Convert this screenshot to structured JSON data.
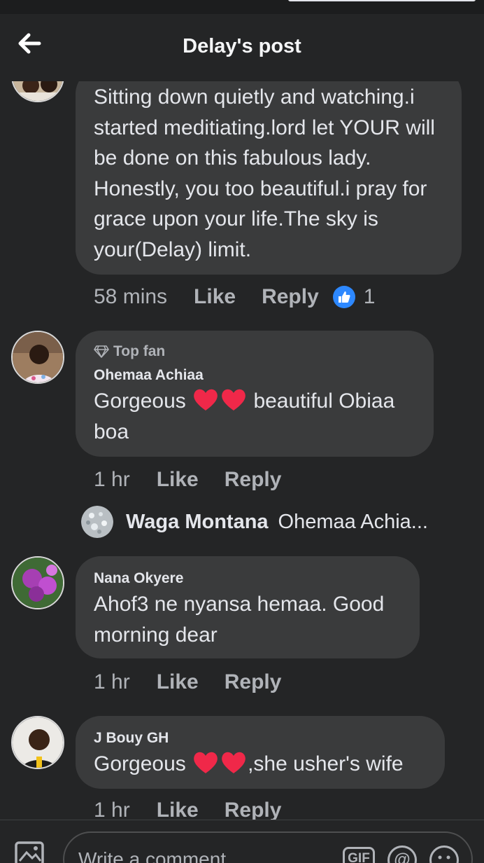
{
  "header": {
    "title": "Delay's post"
  },
  "comments": [
    {
      "text": "Sitting down quietly and watching.i started meditiating.lord let YOUR will be done on this fabulous lady. Honestly, you too beautiful.i pray for grace upon your life.The sky is your(Delay) limit.",
      "time": "58 mins",
      "like_label": "Like",
      "reply_label": "Reply",
      "reaction_count": "1"
    },
    {
      "badge": "Top fan",
      "name": "Ohemaa Achiaa",
      "text_before": "Gorgeous",
      "text_after": "beautiful Obiaa boa",
      "time": "1 hr",
      "like_label": "Like",
      "reply_label": "Reply",
      "reply_preview": {
        "name": "Waga Montana",
        "text": "Ohemaa Achia..."
      }
    },
    {
      "name": "Nana Okyere",
      "text": "Ahof3 ne nyansa hemaa. Good morning dear",
      "time": "1 hr",
      "like_label": "Like",
      "reply_label": "Reply"
    },
    {
      "name": "J Bouy GH",
      "text_before": "Gorgeous",
      "text_after": ",she usher's wife",
      "time": "1 hr",
      "like_label": "Like",
      "reply_label": "Reply"
    }
  ],
  "composer": {
    "placeholder": "Write a comment...",
    "gif_label": "GIF",
    "mention_label": "@"
  },
  "colors": {
    "background": "#242526",
    "bubble": "#3a3b3c",
    "text": "#e4e6eb",
    "muted": "#b0b3b8",
    "like_blue": "#2d88ff",
    "heart": "#f02849"
  }
}
